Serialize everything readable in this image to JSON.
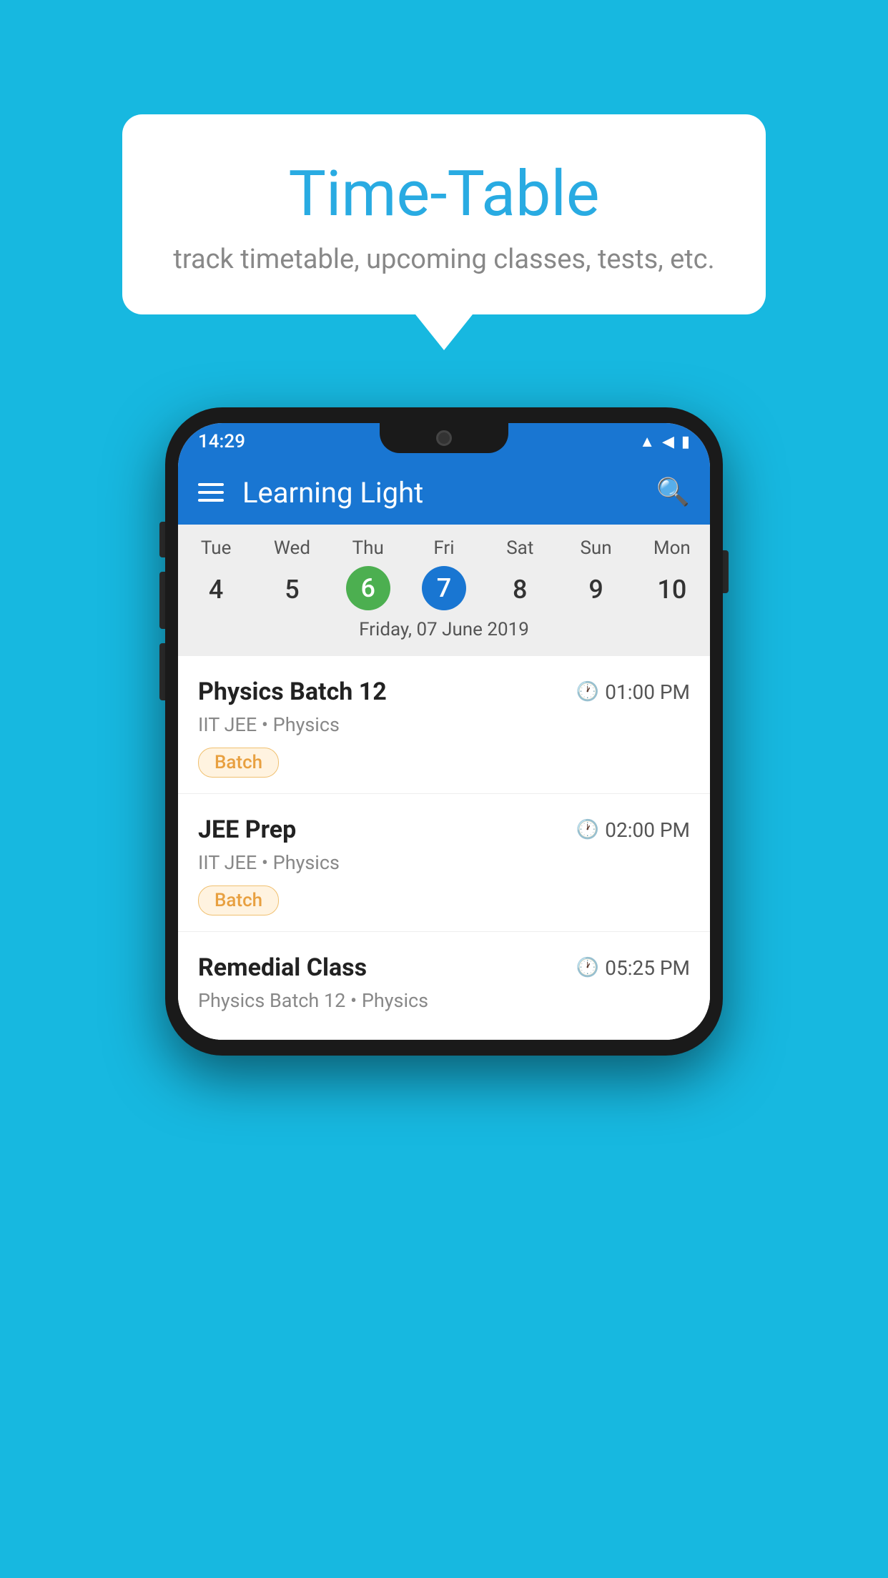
{
  "background_color": "#17B8E0",
  "speech_bubble": {
    "title": "Time-Table",
    "subtitle": "track timetable, upcoming classes, tests, etc."
  },
  "phone": {
    "status_bar": {
      "time": "14:29",
      "icons": [
        "wifi",
        "signal",
        "battery"
      ]
    },
    "app_bar": {
      "title": "Learning Light"
    },
    "calendar": {
      "days": [
        "Tue",
        "Wed",
        "Thu",
        "Fri",
        "Sat",
        "Sun",
        "Mon"
      ],
      "dates": [
        "4",
        "5",
        "6",
        "7",
        "8",
        "9",
        "10"
      ],
      "today_index": 2,
      "selected_index": 3,
      "selected_label": "Friday, 07 June 2019"
    },
    "classes": [
      {
        "name": "Physics Batch 12",
        "time": "01:00 PM",
        "subject": "IIT JEE • Physics",
        "badge": "Batch"
      },
      {
        "name": "JEE Prep",
        "time": "02:00 PM",
        "subject": "IIT JEE • Physics",
        "badge": "Batch"
      },
      {
        "name": "Remedial Class",
        "time": "05:25 PM",
        "subject": "Physics Batch 12 • Physics",
        "badge": null
      }
    ]
  }
}
